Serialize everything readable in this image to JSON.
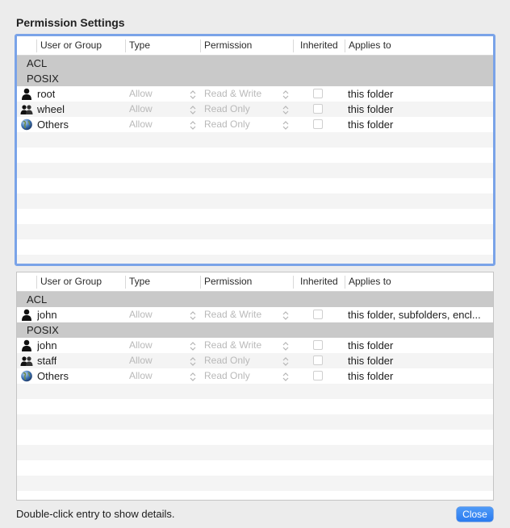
{
  "title": "Permission Settings",
  "columns": {
    "user": "User or Group",
    "type": "Type",
    "permission": "Permission",
    "inherited": "Inherited",
    "applies": "Applies to"
  },
  "table1": {
    "groups": {
      "acl": "ACL",
      "posix": "POSIX"
    },
    "rows": [
      {
        "icon": "single-user-icon",
        "name": "root",
        "type": "Allow",
        "permission": "Read & Write",
        "inherited": false,
        "applies": "this folder"
      },
      {
        "icon": "group-icon",
        "name": "wheel",
        "type": "Allow",
        "permission": "Read Only",
        "inherited": false,
        "applies": "this folder"
      },
      {
        "icon": "globe-icon",
        "name": "Others",
        "type": "Allow",
        "permission": "Read Only",
        "inherited": false,
        "applies": "this folder"
      }
    ]
  },
  "table2": {
    "groups": {
      "acl": "ACL",
      "posix": "POSIX"
    },
    "acl_rows": [
      {
        "icon": "single-user-icon",
        "name": "john",
        "type": "Allow",
        "permission": "Read & Write",
        "inherited": false,
        "applies": "this folder, subfolders, encl..."
      }
    ],
    "rows": [
      {
        "icon": "single-user-icon",
        "name": "john",
        "type": "Allow",
        "permission": "Read & Write",
        "inherited": false,
        "applies": "this folder"
      },
      {
        "icon": "group-icon",
        "name": "staff",
        "type": "Allow",
        "permission": "Read Only",
        "inherited": false,
        "applies": "this folder"
      },
      {
        "icon": "globe-icon",
        "name": "Others",
        "type": "Allow",
        "permission": "Read Only",
        "inherited": false,
        "applies": "this folder"
      }
    ]
  },
  "footer": {
    "hint": "Double-click entry to show details.",
    "close_label": "Close"
  }
}
